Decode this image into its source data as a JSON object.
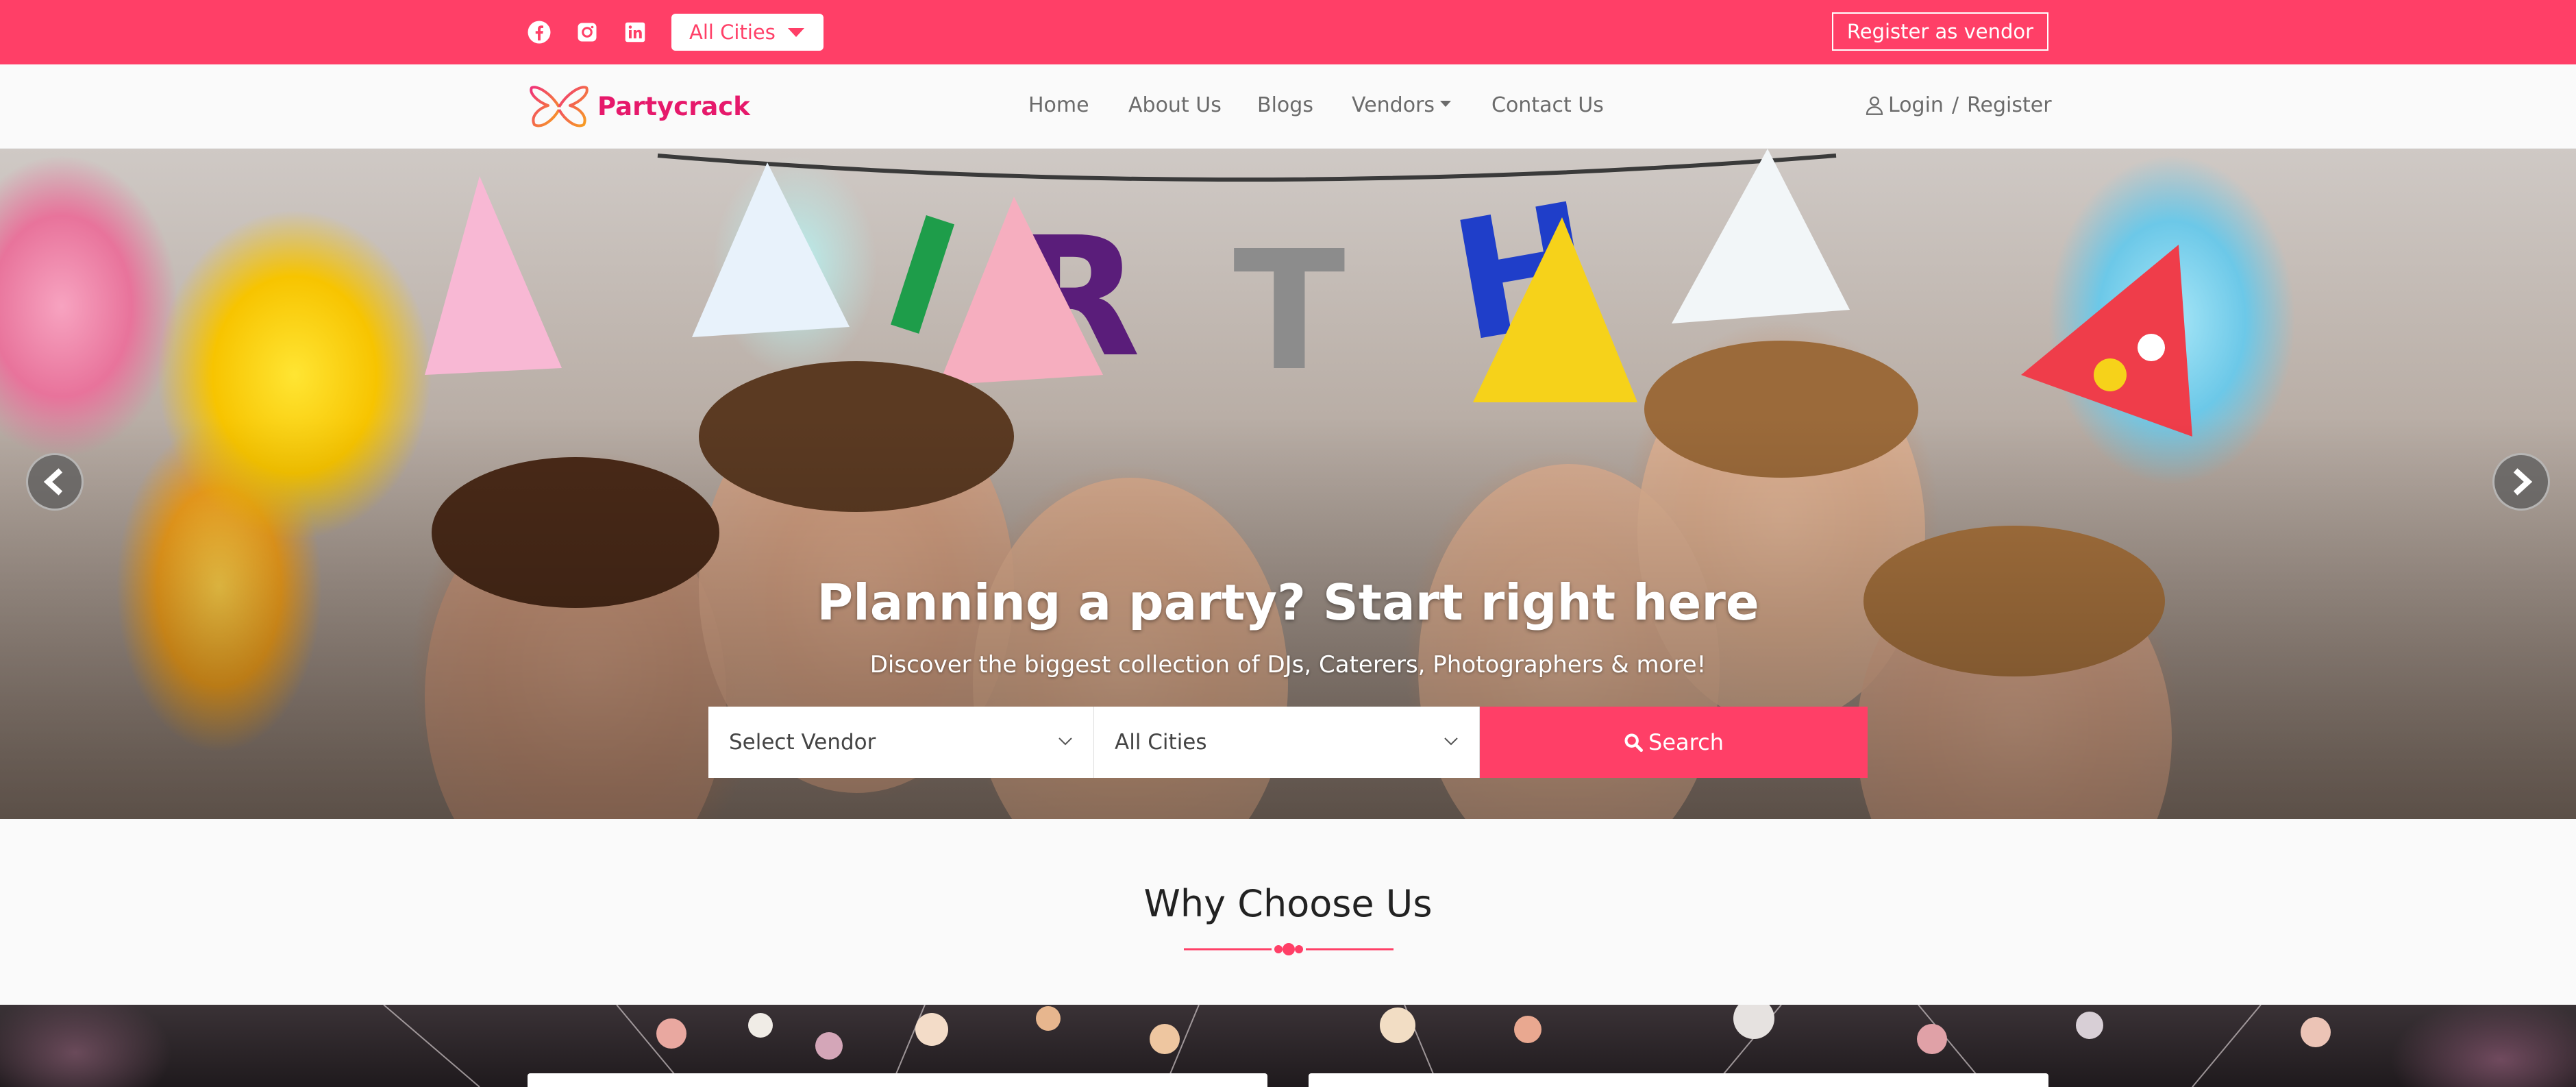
{
  "topbar": {
    "social": [
      "facebook-icon",
      "instagram-icon",
      "linkedin-icon"
    ],
    "city_select": "All Cities",
    "vendor_button": "Register as vendor",
    "color": "#ff3f67"
  },
  "nav": {
    "brand": "Partycrack",
    "links": [
      "Home",
      "About Us",
      "Blogs",
      "Vendors",
      "Contact Us"
    ],
    "login": "Login",
    "separator": "/",
    "register": "Register"
  },
  "hero": {
    "title": "Planning a party? Start right here",
    "subtitle": "Discover the biggest collection of DJs, Caterers, Photographers & more!",
    "vendor_select": "Select Vendor",
    "city_select": "All Cities",
    "search_label": "Search",
    "prev_icon": "chevron-left-icon",
    "next_icon": "chevron-right-icon"
  },
  "why": {
    "title": "Why Choose Us"
  },
  "colors": {
    "accent": "#ff3f67",
    "brand": "#e6196b"
  }
}
